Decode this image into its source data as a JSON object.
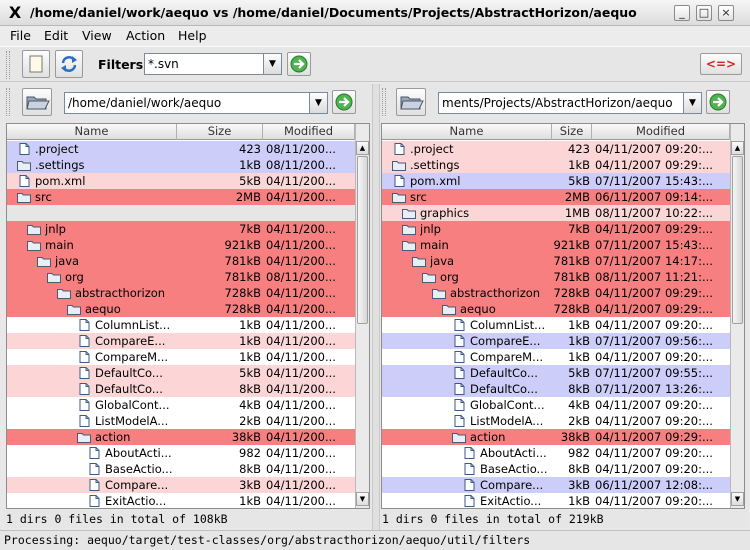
{
  "window": {
    "title": "/home/daniel/work/aequo vs /home/daniel/Documents/Projects/AbstractHorizon/aequo",
    "app_icon": "X",
    "minimize": "_",
    "maximize": "□",
    "close": "×"
  },
  "menu": [
    "File",
    "Edit",
    "View",
    "Action",
    "Help"
  ],
  "toolbar": {
    "filters_label": "Filters:",
    "filter_value": "*.svn",
    "compare_label": "<=>"
  },
  "left": {
    "path": "/home/daniel/work/aequo",
    "columns": [
      "Name",
      "Size",
      "Modified"
    ],
    "status": "1 dirs 0 files in total of 108kB",
    "rows": [
      {
        "name": ".project",
        "size": "423",
        "mod": "08/11/200...",
        "type": "file",
        "indent": 0,
        "bg": "blue"
      },
      {
        "name": ".settings",
        "size": "1kB",
        "mod": "08/11/200...",
        "type": "folder",
        "indent": 0,
        "bg": "blue"
      },
      {
        "name": "pom.xml",
        "size": "5kB",
        "mod": "04/11/200...",
        "type": "file",
        "indent": 0,
        "bg": "pink"
      },
      {
        "name": "src",
        "size": "2MB",
        "mod": "04/11/200...",
        "type": "folder",
        "indent": 0,
        "bg": "red"
      },
      {
        "name": "",
        "size": "",
        "mod": "",
        "type": "none",
        "indent": 0,
        "bg": "gray"
      },
      {
        "name": "jnlp",
        "size": "7kB",
        "mod": "04/11/200...",
        "type": "folder",
        "indent": 1,
        "bg": "red"
      },
      {
        "name": "main",
        "size": "921kB",
        "mod": "04/11/200...",
        "type": "folder",
        "indent": 1,
        "bg": "red"
      },
      {
        "name": "java",
        "size": "781kB",
        "mod": "04/11/200...",
        "type": "folder",
        "indent": 2,
        "bg": "red"
      },
      {
        "name": "org",
        "size": "781kB",
        "mod": "08/11/200...",
        "type": "folder",
        "indent": 3,
        "bg": "red"
      },
      {
        "name": "abstracthorizon",
        "size": "728kB",
        "mod": "04/11/200...",
        "type": "folder",
        "indent": 4,
        "bg": "red"
      },
      {
        "name": "aequo",
        "size": "728kB",
        "mod": "04/11/200...",
        "type": "folder",
        "indent": 5,
        "bg": "red"
      },
      {
        "name": "ColumnList...",
        "size": "1kB",
        "mod": "04/11/200...",
        "type": "file",
        "indent": 6,
        "bg": "white"
      },
      {
        "name": "CompareE...",
        "size": "1kB",
        "mod": "04/11/200...",
        "type": "file",
        "indent": 6,
        "bg": "pink"
      },
      {
        "name": "CompareM...",
        "size": "1kB",
        "mod": "04/11/200...",
        "type": "file",
        "indent": 6,
        "bg": "white"
      },
      {
        "name": "DefaultCo...",
        "size": "5kB",
        "mod": "04/11/200...",
        "type": "file",
        "indent": 6,
        "bg": "pink"
      },
      {
        "name": "DefaultCo...",
        "size": "8kB",
        "mod": "04/11/200...",
        "type": "file",
        "indent": 6,
        "bg": "pink"
      },
      {
        "name": "GlobalCont...",
        "size": "4kB",
        "mod": "04/11/200...",
        "type": "file",
        "indent": 6,
        "bg": "white"
      },
      {
        "name": "ListModelA...",
        "size": "2kB",
        "mod": "04/11/200...",
        "type": "file",
        "indent": 6,
        "bg": "white"
      },
      {
        "name": "action",
        "size": "38kB",
        "mod": "04/11/200...",
        "type": "folder",
        "indent": 6,
        "bg": "red"
      },
      {
        "name": "AboutActi...",
        "size": "982",
        "mod": "04/11/200...",
        "type": "file",
        "indent": 7,
        "bg": "white"
      },
      {
        "name": "BaseActio...",
        "size": "8kB",
        "mod": "04/11/200...",
        "type": "file",
        "indent": 7,
        "bg": "white"
      },
      {
        "name": "Compare...",
        "size": "3kB",
        "mod": "04/11/200...",
        "type": "file",
        "indent": 7,
        "bg": "pink"
      },
      {
        "name": "ExitActio...",
        "size": "1kB",
        "mod": "04/11/200...",
        "type": "file",
        "indent": 7,
        "bg": "white"
      }
    ]
  },
  "right": {
    "path": "ments/Projects/AbstractHorizon/aequo",
    "columns": [
      "Name",
      "Size",
      "Modified"
    ],
    "status": "1 dirs 0 files in total of 219kB",
    "rows": [
      {
        "name": ".project",
        "size": "423",
        "mod": "04/11/2007 09:20:...",
        "type": "file",
        "indent": 0,
        "bg": "pink"
      },
      {
        "name": ".settings",
        "size": "1kB",
        "mod": "04/11/2007 09:29:...",
        "type": "folder",
        "indent": 0,
        "bg": "pink"
      },
      {
        "name": "pom.xml",
        "size": "5kB",
        "mod": "07/11/2007 15:43:...",
        "type": "file",
        "indent": 0,
        "bg": "blue"
      },
      {
        "name": "src",
        "size": "2MB",
        "mod": "06/11/2007 09:14:...",
        "type": "folder",
        "indent": 0,
        "bg": "red"
      },
      {
        "name": "graphics",
        "size": "1MB",
        "mod": "08/11/2007 10:22:...",
        "type": "folder",
        "indent": 1,
        "bg": "pink"
      },
      {
        "name": "jnlp",
        "size": "7kB",
        "mod": "04/11/2007 09:29:...",
        "type": "folder",
        "indent": 1,
        "bg": "red"
      },
      {
        "name": "main",
        "size": "921kB",
        "mod": "07/11/2007 15:43:...",
        "type": "folder",
        "indent": 1,
        "bg": "red"
      },
      {
        "name": "java",
        "size": "781kB",
        "mod": "07/11/2007 14:17:...",
        "type": "folder",
        "indent": 2,
        "bg": "red"
      },
      {
        "name": "org",
        "size": "781kB",
        "mod": "08/11/2007 11:21:...",
        "type": "folder",
        "indent": 3,
        "bg": "red"
      },
      {
        "name": "abstracthorizon",
        "size": "728kB",
        "mod": "04/11/2007 09:29:...",
        "type": "folder",
        "indent": 4,
        "bg": "red"
      },
      {
        "name": "aequo",
        "size": "728kB",
        "mod": "04/11/2007 09:29:...",
        "type": "folder",
        "indent": 5,
        "bg": "red"
      },
      {
        "name": "ColumnList...",
        "size": "1kB",
        "mod": "04/11/2007 09:20:...",
        "type": "file",
        "indent": 6,
        "bg": "white"
      },
      {
        "name": "CompareE...",
        "size": "1kB",
        "mod": "07/11/2007 09:56:...",
        "type": "file",
        "indent": 6,
        "bg": "blue"
      },
      {
        "name": "CompareM...",
        "size": "1kB",
        "mod": "04/11/2007 09:20:...",
        "type": "file",
        "indent": 6,
        "bg": "white"
      },
      {
        "name": "DefaultCo...",
        "size": "5kB",
        "mod": "07/11/2007 09:55:...",
        "type": "file",
        "indent": 6,
        "bg": "blue"
      },
      {
        "name": "DefaultCo...",
        "size": "8kB",
        "mod": "07/11/2007 13:26:...",
        "type": "file",
        "indent": 6,
        "bg": "blue"
      },
      {
        "name": "GlobalCont...",
        "size": "4kB",
        "mod": "04/11/2007 09:20:...",
        "type": "file",
        "indent": 6,
        "bg": "white"
      },
      {
        "name": "ListModelA...",
        "size": "2kB",
        "mod": "04/11/2007 09:20:...",
        "type": "file",
        "indent": 6,
        "bg": "white"
      },
      {
        "name": "action",
        "size": "38kB",
        "mod": "04/11/2007 09:29:...",
        "type": "folder",
        "indent": 6,
        "bg": "red"
      },
      {
        "name": "AboutActi...",
        "size": "982",
        "mod": "04/11/2007 09:20:...",
        "type": "file",
        "indent": 7,
        "bg": "white"
      },
      {
        "name": "BaseActio...",
        "size": "8kB",
        "mod": "04/11/2007 09:20:...",
        "type": "file",
        "indent": 7,
        "bg": "white"
      },
      {
        "name": "Compare...",
        "size": "3kB",
        "mod": "06/11/2007 12:08:...",
        "type": "file",
        "indent": 7,
        "bg": "blue"
      },
      {
        "name": "ExitActio...",
        "size": "1kB",
        "mod": "04/11/2007 09:20:...",
        "type": "file",
        "indent": 7,
        "bg": "white"
      }
    ]
  },
  "statusbar": "Processing: aequo/target/test-classes/org/abstracthorizon/aequo/util/filters",
  "colors": {
    "pink": "#fcd6d6",
    "red": "#f77f7f",
    "blue": "#cdcdfa",
    "white": "#ffffff",
    "gray": "#e6e6e6"
  }
}
